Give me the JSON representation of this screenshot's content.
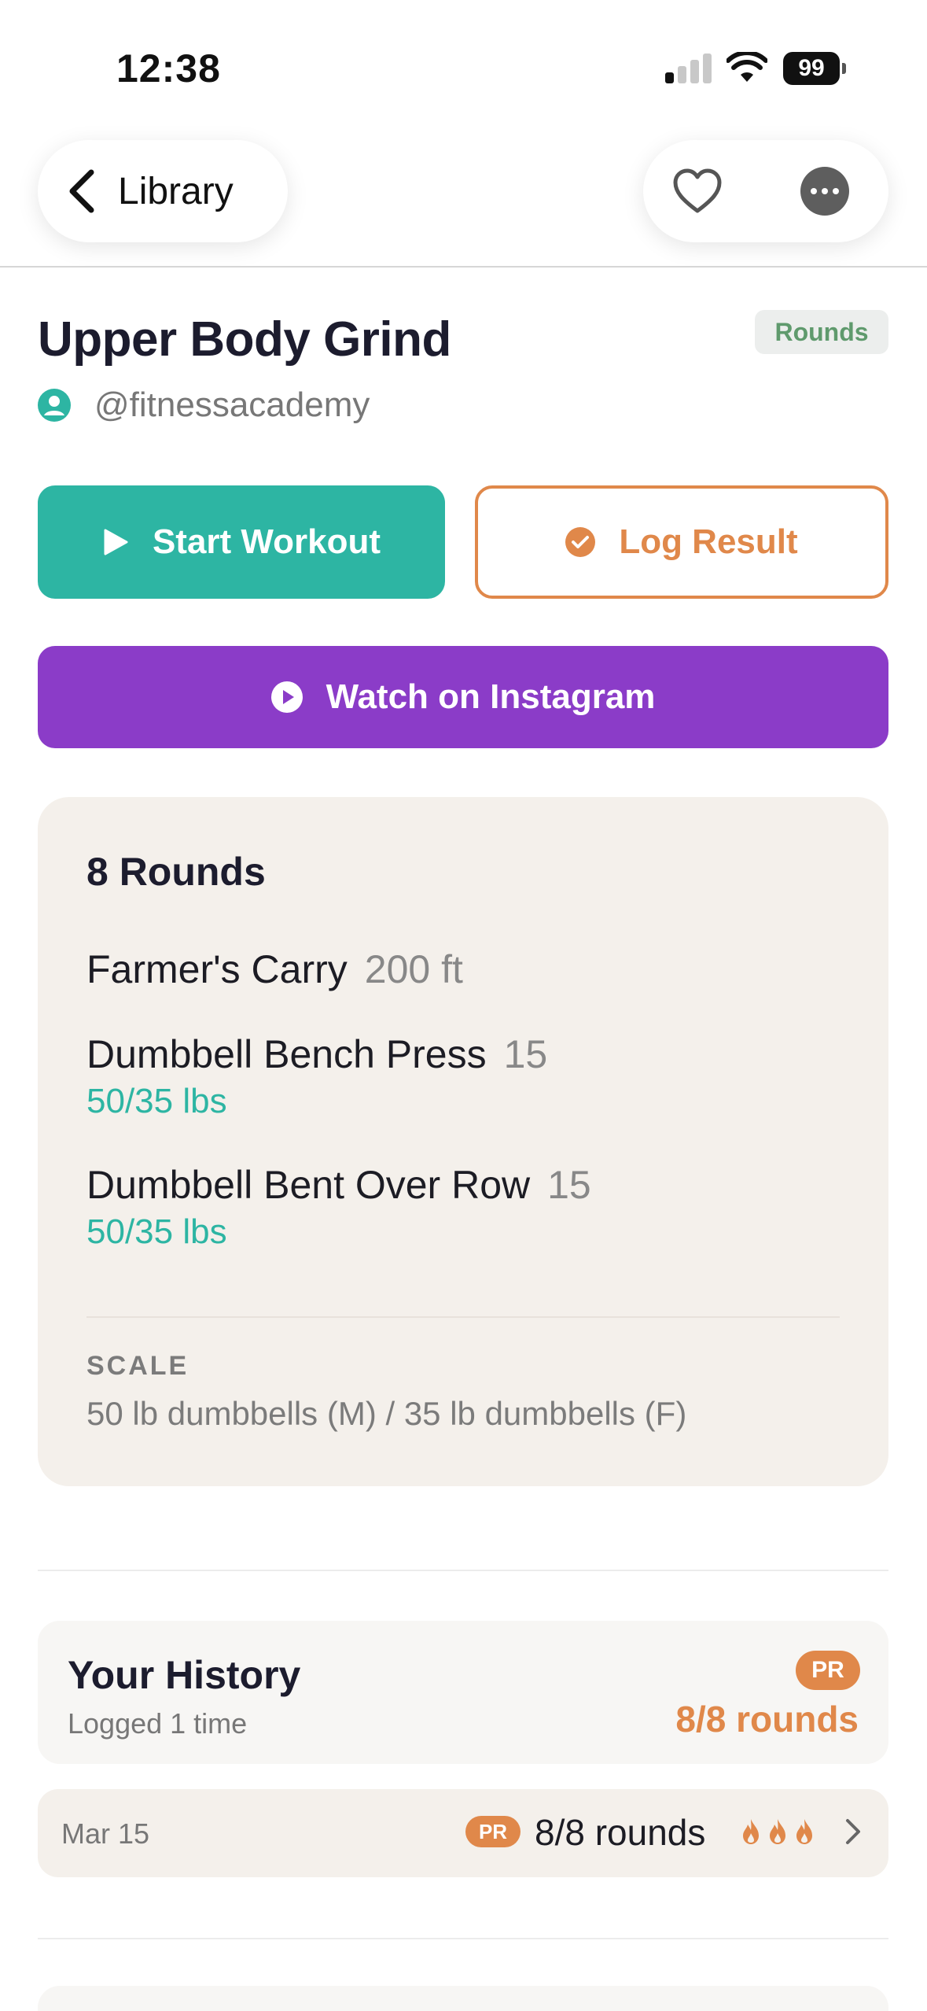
{
  "status_bar": {
    "time": "12:38",
    "battery": "99"
  },
  "nav": {
    "back_label": "Library"
  },
  "workout": {
    "title": "Upper Body Grind",
    "type_tag": "Rounds",
    "author": "@fitnessacademy"
  },
  "actions": {
    "start": "Start Workout",
    "log": "Log Result",
    "instagram": "Watch on Instagram"
  },
  "card": {
    "heading": "8 Rounds",
    "exercises": [
      {
        "name": "Farmer's Carry",
        "qty": "200 ft",
        "weight": ""
      },
      {
        "name": "Dumbbell Bench Press",
        "qty": "15",
        "weight": "50/35 lbs"
      },
      {
        "name": "Dumbbell Bent Over Row",
        "qty": "15",
        "weight": "50/35 lbs"
      }
    ],
    "scale_label": "SCALE",
    "scale_text": "50 lb dumbbells (M) / 35 lb dumbbells (F)"
  },
  "history": {
    "title": "Your History",
    "subtitle": "Logged 1 time",
    "badge": "PR",
    "best": "8/8 rounds",
    "entries": [
      {
        "date": "Mar 15",
        "badge": "PR",
        "result": "8/8 rounds",
        "intensity": 3
      }
    ]
  },
  "colors": {
    "teal": "#2db5a3",
    "orange": "#e0884a",
    "purple": "#8b3cc8",
    "card_bg": "#f4f0eb"
  }
}
